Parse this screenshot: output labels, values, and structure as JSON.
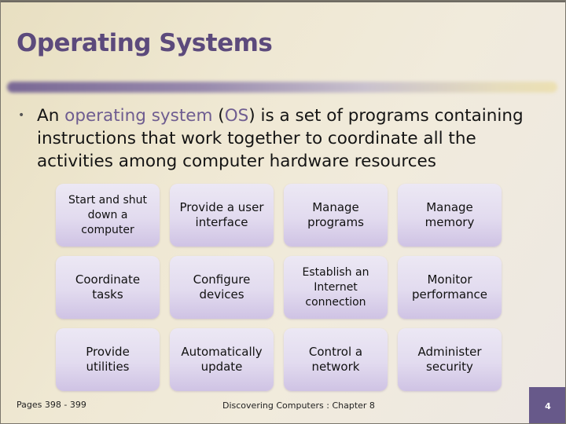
{
  "slide": {
    "title": "Operating Systems",
    "bullet": {
      "glyph": "•",
      "segments": {
        "s1": "An ",
        "s2": "operating system",
        "s3": " (",
        "s4": "OS",
        "s5": ") is a set of programs containing"
      },
      "line2": "instructions that work together to coordinate all the",
      "line3": "activities among computer hardware resources"
    },
    "functions": [
      "Start and shut down a computer",
      "Provide a user interface",
      "Manage programs",
      "Manage memory",
      "Coordinate tasks",
      "Configure devices",
      "Establish an Internet connection",
      "Monitor performance",
      "Provide utilities",
      "Automatically update",
      "Control a network",
      "Administer security"
    ],
    "footer": {
      "pages": "Pages 398 - 399",
      "source": "Discovering Computers : Chapter 8",
      "page_number": "4"
    },
    "colors": {
      "accent": "#5c4a7c",
      "page_box": "#67598a"
    }
  }
}
